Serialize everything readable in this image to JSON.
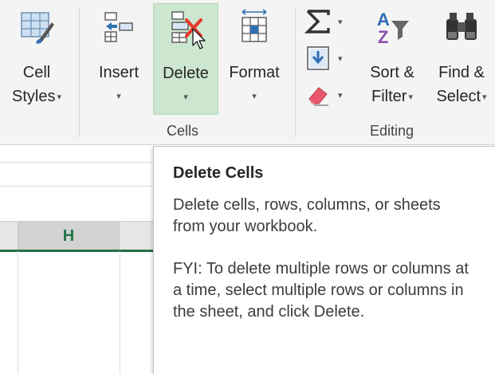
{
  "ribbon": {
    "cells_group": {
      "label": "Cells",
      "cell_styles": {
        "line1": "Cell",
        "line2": "Styles",
        "icon": "cell-styles-icon"
      },
      "insert": {
        "label": "Insert",
        "icon": "insert-cells-icon"
      },
      "delete": {
        "label": "Delete",
        "icon": "delete-cells-icon",
        "accent": "#e8382c"
      },
      "format": {
        "label": "Format",
        "icon": "format-cells-icon"
      }
    },
    "editing_group": {
      "label": "Editing",
      "autosum_icon": "autosum-icon",
      "fill_icon": "fill-down-icon",
      "clear_icon": "eraser-icon",
      "sort_filter": {
        "line1": "Sort &",
        "line2": "Filter",
        "icon": "sort-filter-icon"
      },
      "find_select": {
        "line1": "Find &",
        "line2": "Select",
        "icon": "binoculars-icon"
      }
    },
    "caret": "▾"
  },
  "sheet": {
    "column_label": "H",
    "accent": "#217346"
  },
  "tooltip": {
    "title": "Delete Cells",
    "body": "Delete cells, rows, columns, or sheets from your workbook.",
    "fyi": "FYI: To delete multiple rows or columns at a time, select multiple rows or columns in the sheet, and click Delete."
  }
}
